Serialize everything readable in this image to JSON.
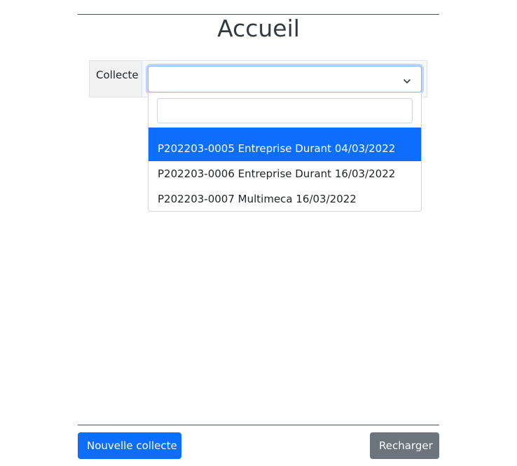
{
  "header": {
    "title": "Accueil"
  },
  "form": {
    "collecte_label": "Collecte",
    "select": {
      "value": "",
      "search_value": "",
      "options": [
        "P202203-0005 Entreprise Durant 04/03/2022",
        "P202203-0006 Entreprise Durant 16/03/2022",
        "P202203-0007 Multimeca 16/03/2022"
      ],
      "highlighted_index": 0
    }
  },
  "footer": {
    "new_button": "Nouvelle collecte",
    "reload_button": "Recharger"
  },
  "colors": {
    "primary": "#0d6efd",
    "secondary": "#6c757d"
  },
  "icons": {
    "select_toggle": "chevron-down-icon"
  }
}
